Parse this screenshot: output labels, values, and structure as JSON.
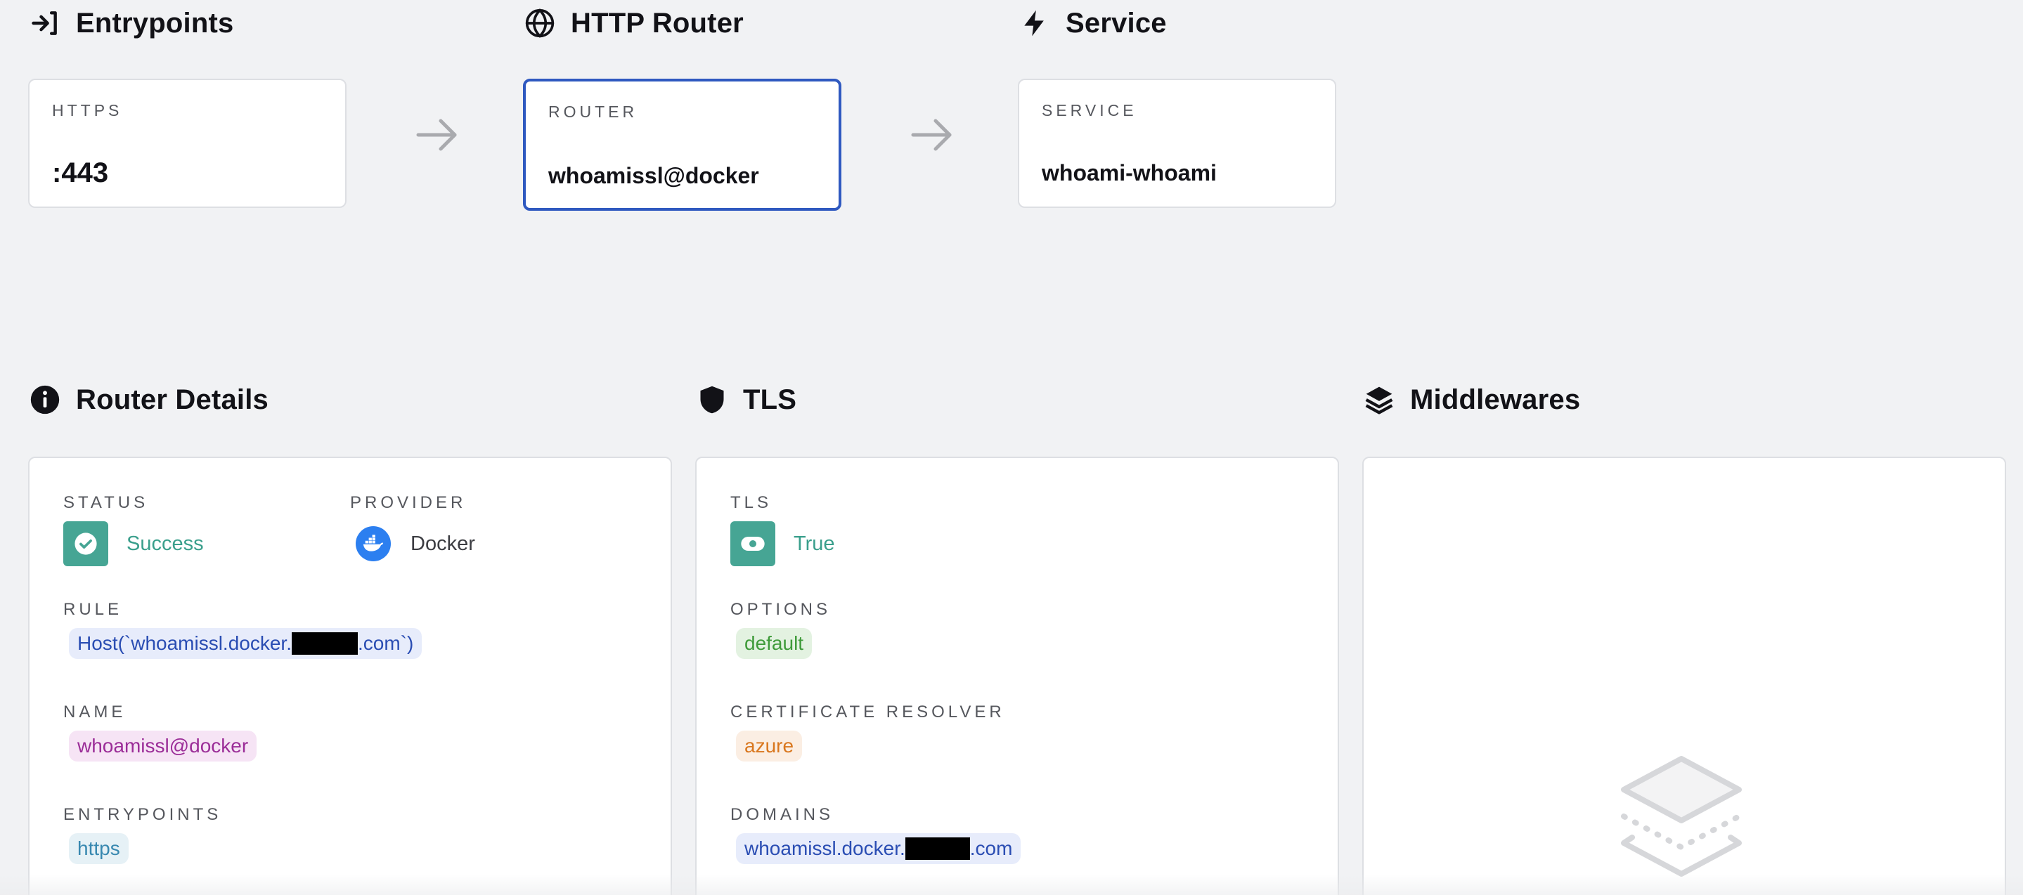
{
  "flow": {
    "entrypoints": {
      "title": "Entrypoints",
      "caption": "HTTPS",
      "value": ":443"
    },
    "router": {
      "title": "HTTP Router",
      "caption": "ROUTER",
      "value": "whoamissl@docker"
    },
    "service": {
      "title": "Service",
      "caption": "SERVICE",
      "value": "whoami-whoami"
    }
  },
  "router_details": {
    "title": "Router Details",
    "status_label": "STATUS",
    "status_value": "Success",
    "provider_label": "PROVIDER",
    "provider_value": "Docker",
    "rule_label": "RULE",
    "rule_prefix": "Host(`whoamissl.docker.",
    "rule_suffix": ".com`)",
    "name_label": "NAME",
    "name_value": "whoamissl@docker",
    "entrypoints_label": "ENTRYPOINTS",
    "entrypoints_value": "https"
  },
  "tls": {
    "title": "TLS",
    "tls_label": "TLS",
    "tls_value": "True",
    "options_label": "OPTIONS",
    "options_value": "default",
    "resolver_label": "CERTIFICATE RESOLVER",
    "resolver_value": "azure",
    "domains_label": "DOMAINS",
    "domain_prefix": "whoamissl.docker.",
    "domain_suffix": ".com"
  },
  "middlewares": {
    "title": "Middlewares"
  },
  "icons": {
    "entrypoints": "login-arrow-icon",
    "router": "globe-icon",
    "service": "lightning-bolt-icon",
    "details": "info-icon",
    "tls": "shield-icon",
    "middlewares": "layers-icon",
    "flow_arrow": "arrow-right-icon",
    "status": "check-circle-icon",
    "provider": "docker-icon",
    "tls_toggle": "toggle-icon",
    "empty": "empty-layers-icon"
  },
  "colors": {
    "accent_border": "#2f59c0",
    "success": "#46a594",
    "docker": "#2c7ff0"
  }
}
